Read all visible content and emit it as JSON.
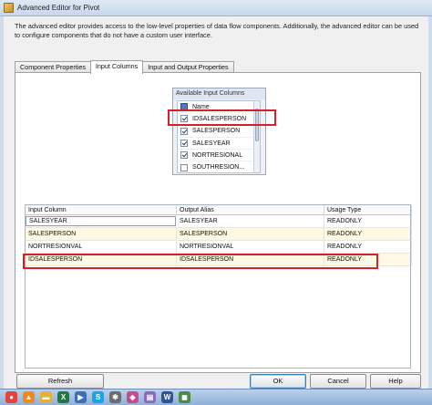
{
  "window": {
    "title": "Advanced Editor for Pivot"
  },
  "description": "The advanced editor provides access to the low-level properties of data flow components. Additionally, the advanced editor can be used to configure components that do not have a custom user interface.",
  "tabs": [
    {
      "label": "Component Properties",
      "active": false
    },
    {
      "label": "Input Columns",
      "active": true
    },
    {
      "label": "Input and Output Properties",
      "active": false
    }
  ],
  "available_columns": {
    "title": "Available Input Columns",
    "header_label": "Name",
    "items": [
      {
        "label": "IDSALESPERSON",
        "checked": true
      },
      {
        "label": "SALESPERSON",
        "checked": true
      },
      {
        "label": "SALESYEAR",
        "checked": true
      },
      {
        "label": "NORTRESIONAL",
        "checked": true
      },
      {
        "label": "SOUTHRESION...",
        "checked": false
      }
    ]
  },
  "grid": {
    "columns": [
      "Input Column",
      "Output Alias",
      "Usage Type"
    ],
    "rows": [
      {
        "input": "SALESYEAR",
        "alias": "SALESYEAR",
        "usage": "READONLY"
      },
      {
        "input": "SALESPERSON",
        "alias": "SALESPERSON",
        "usage": "READONLY"
      },
      {
        "input": "NORTRESIONVAL",
        "alias": "NORTRESIONVAL",
        "usage": "READONLY"
      },
      {
        "input": "IDSALESPERSON",
        "alias": "IDSALESPERSON",
        "usage": "READONLY"
      }
    ]
  },
  "buttons": {
    "refresh": "Refresh",
    "ok": "OK",
    "cancel": "Cancel",
    "help": "Help"
  },
  "taskbar": {
    "icons": [
      {
        "name": "chrome-icon",
        "color": "#e0443a",
        "glyph": "●"
      },
      {
        "name": "vlc-icon",
        "color": "#f08a1c",
        "glyph": "▲"
      },
      {
        "name": "folder-icon",
        "color": "#e3b23c",
        "glyph": "▬"
      },
      {
        "name": "excel-icon",
        "color": "#1f7a3d",
        "glyph": "X"
      },
      {
        "name": "media-icon",
        "color": "#3b6fb6",
        "glyph": "▶"
      },
      {
        "name": "skype-icon",
        "color": "#1aa3e6",
        "glyph": "S"
      },
      {
        "name": "tool-icon",
        "color": "#6d6d6d",
        "glyph": "✱"
      },
      {
        "name": "paint-icon",
        "color": "#c94a8c",
        "glyph": "◆"
      },
      {
        "name": "notes-icon",
        "color": "#8a6bb8",
        "glyph": "▤"
      },
      {
        "name": "word-icon",
        "color": "#2b579a",
        "glyph": "W"
      },
      {
        "name": "app-icon",
        "color": "#4a8a4a",
        "glyph": "◼"
      }
    ]
  }
}
